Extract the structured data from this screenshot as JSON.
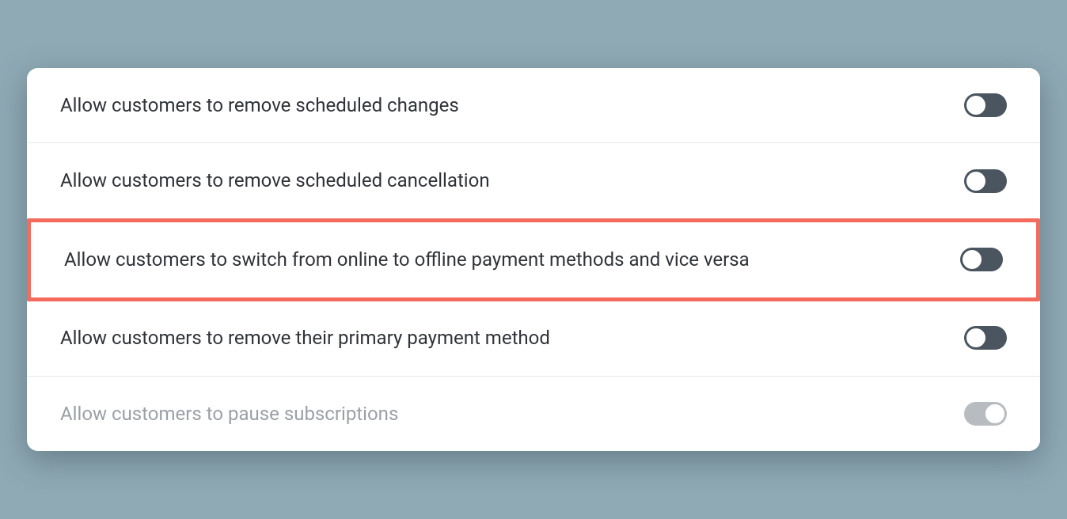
{
  "settings": [
    {
      "label": "Allow customers to remove scheduled changes",
      "state": "on",
      "highlighted": false,
      "disabled": false
    },
    {
      "label": "Allow customers to remove scheduled cancellation",
      "state": "on",
      "highlighted": false,
      "disabled": false
    },
    {
      "label": "Allow customers to switch from online to offline payment methods and vice versa",
      "state": "on",
      "highlighted": true,
      "disabled": false
    },
    {
      "label": "Allow customers to remove their primary payment method",
      "state": "on",
      "highlighted": false,
      "disabled": false
    },
    {
      "label": "Allow customers to pause subscriptions",
      "state": "off",
      "highlighted": false,
      "disabled": true
    }
  ]
}
